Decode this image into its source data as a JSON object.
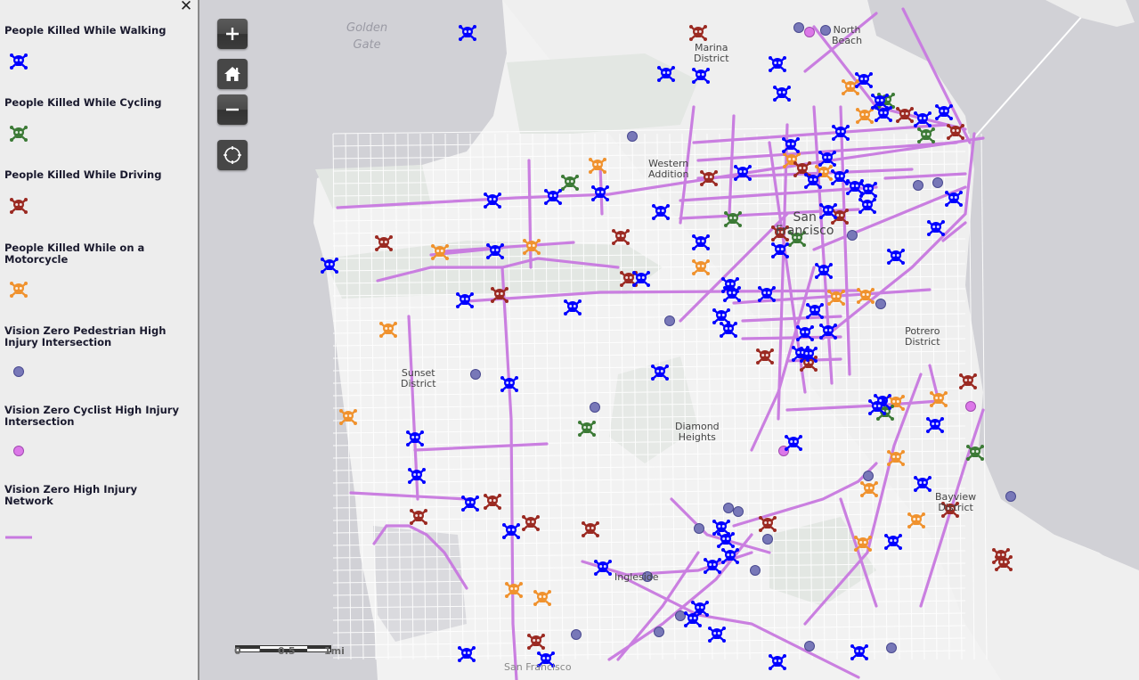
{
  "legend": {
    "close_label": "✕",
    "items": [
      {
        "label": "People Killed While Walking",
        "symbol": "skull-icon",
        "color": "#0000ff"
      },
      {
        "label": "People Killed While Cycling",
        "symbol": "skull-icon",
        "color": "#3c7a36"
      },
      {
        "label": "People Killed While Driving",
        "symbol": "skull-icon",
        "color": "#9b2a22"
      },
      {
        "label": "People Killed While on a Motorcycle",
        "symbol": "skull-icon",
        "color": "#f0922e"
      },
      {
        "label": "Vision Zero Pedestrian High Injury Intersection",
        "symbol": "circle-icon",
        "color": "#7878b8"
      },
      {
        "label": "Vision Zero Cyclist High Injury Intersection",
        "symbol": "circle-icon",
        "color": "#dc78e8"
      },
      {
        "label": "Vision Zero High Injury Network",
        "symbol": "line-icon",
        "color": "#c879e0"
      }
    ]
  },
  "controls": {
    "zoom_in": "+",
    "zoom_out": "−"
  },
  "map_labels": {
    "water_golden_gate": "Golden\nGate",
    "marina": "Marina\nDistrict",
    "north_beach": "North\nBeach",
    "western_addition": "Western\nAddition",
    "san_francisco": "San\nFrancisco",
    "sunset": "Sunset\nDistrict",
    "diamond_heights": "Diamond\nHeights",
    "potrero": "Potrero\nDistrict",
    "bayview": "Bayview\nDistrict",
    "ingleside": "Ingleside",
    "san_francisco_south": "San Francisco"
  },
  "scale_bar": {
    "labels": [
      "0",
      "0.5",
      "1mi"
    ]
  },
  "colors": {
    "walking": "#0000ff",
    "cycling": "#3c7a36",
    "driving": "#9b2a22",
    "motorcycle": "#f0922e",
    "ped_intersection": "#7878b8",
    "cyc_intersection": "#dc78e8",
    "network": "#c879e0"
  },
  "markers": {
    "walking": [
      [
        525,
        37
      ],
      [
        748,
        83
      ],
      [
        787,
        85
      ],
      [
        873,
        72
      ],
      [
        878,
        105
      ],
      [
        970,
        90
      ],
      [
        988,
        114
      ],
      [
        992,
        128
      ],
      [
        1060,
        126
      ],
      [
        1036,
        134
      ],
      [
        944,
        149
      ],
      [
        888,
        163
      ],
      [
        929,
        178
      ],
      [
        834,
        194
      ],
      [
        913,
        203
      ],
      [
        943,
        199
      ],
      [
        960,
        210
      ],
      [
        975,
        213
      ],
      [
        553,
        225
      ],
      [
        621,
        221
      ],
      [
        674,
        217
      ],
      [
        742,
        238
      ],
      [
        930,
        237
      ],
      [
        974,
        231
      ],
      [
        1071,
        223
      ],
      [
        1051,
        256
      ],
      [
        556,
        282
      ],
      [
        787,
        272
      ],
      [
        876,
        281
      ],
      [
        1006,
        288
      ],
      [
        370,
        298
      ],
      [
        720,
        313
      ],
      [
        925,
        304
      ],
      [
        820,
        320
      ],
      [
        822,
        330
      ],
      [
        861,
        330
      ],
      [
        522,
        337
      ],
      [
        643,
        345
      ],
      [
        915,
        349
      ],
      [
        810,
        355
      ],
      [
        818,
        370
      ],
      [
        904,
        374
      ],
      [
        930,
        372
      ],
      [
        899,
        397
      ],
      [
        908,
        398
      ],
      [
        741,
        418
      ],
      [
        572,
        431
      ],
      [
        991,
        451
      ],
      [
        985,
        457
      ],
      [
        1050,
        477
      ],
      [
        466,
        492
      ],
      [
        891,
        497
      ],
      [
        468,
        534
      ],
      [
        1036,
        543
      ],
      [
        528,
        565
      ],
      [
        574,
        596
      ],
      [
        810,
        592
      ],
      [
        1003,
        608
      ],
      [
        815,
        606
      ],
      [
        820,
        624
      ],
      [
        800,
        635
      ],
      [
        677,
        637
      ],
      [
        786,
        683
      ],
      [
        778,
        695
      ],
      [
        805,
        712
      ],
      [
        965,
        732
      ],
      [
        524,
        734
      ],
      [
        613,
        740
      ],
      [
        873,
        743
      ]
    ],
    "cycling": [
      [
        640,
        205
      ],
      [
        823,
        246
      ],
      [
        995,
        113
      ],
      [
        1040,
        152
      ],
      [
        994,
        463
      ],
      [
        659,
        481
      ],
      [
        1095,
        508
      ],
      [
        895,
        268
      ]
    ],
    "driving": [
      [
        784,
        37
      ],
      [
        1016,
        129
      ],
      [
        1073,
        148
      ],
      [
        901,
        190
      ],
      [
        796,
        200
      ],
      [
        943,
        243
      ],
      [
        431,
        273
      ],
      [
        697,
        266
      ],
      [
        706,
        313
      ],
      [
        561,
        331
      ],
      [
        859,
        400
      ],
      [
        908,
        408
      ],
      [
        1087,
        428
      ],
      [
        1067,
        572
      ],
      [
        470,
        580
      ],
      [
        553,
        563
      ],
      [
        596,
        587
      ],
      [
        663,
        594
      ],
      [
        862,
        588
      ],
      [
        1124,
        624
      ],
      [
        1127,
        632
      ],
      [
        602,
        720
      ],
      [
        876,
        262
      ]
    ],
    "motorcycle": [
      [
        955,
        98
      ],
      [
        971,
        130
      ],
      [
        671,
        186
      ],
      [
        889,
        180
      ],
      [
        925,
        194
      ],
      [
        494,
        283
      ],
      [
        597,
        277
      ],
      [
        787,
        300
      ],
      [
        939,
        334
      ],
      [
        972,
        332
      ],
      [
        436,
        370
      ],
      [
        391,
        468
      ],
      [
        1006,
        452
      ],
      [
        1054,
        448
      ],
      [
        1006,
        514
      ],
      [
        976,
        549
      ],
      [
        1029,
        584
      ],
      [
        969,
        610
      ],
      [
        577,
        662
      ],
      [
        609,
        671
      ]
    ],
    "ped_intersection": [
      [
        897,
        31
      ],
      [
        927,
        34
      ],
      [
        710,
        153
      ],
      [
        1031,
        208
      ],
      [
        1053,
        205
      ],
      [
        957,
        264
      ],
      [
        989,
        341
      ],
      [
        752,
        360
      ],
      [
        534,
        420
      ],
      [
        668,
        457
      ],
      [
        975,
        534
      ],
      [
        1135,
        557
      ],
      [
        818,
        570
      ],
      [
        829,
        574
      ],
      [
        785,
        593
      ],
      [
        862,
        605
      ],
      [
        848,
        640
      ],
      [
        727,
        647
      ],
      [
        764,
        691
      ],
      [
        740,
        709
      ],
      [
        647,
        712
      ],
      [
        909,
        725
      ],
      [
        1001,
        727
      ]
    ],
    "cyc_intersection": [
      [
        909,
        36
      ],
      [
        1090,
        456
      ],
      [
        880,
        506
      ]
    ]
  }
}
